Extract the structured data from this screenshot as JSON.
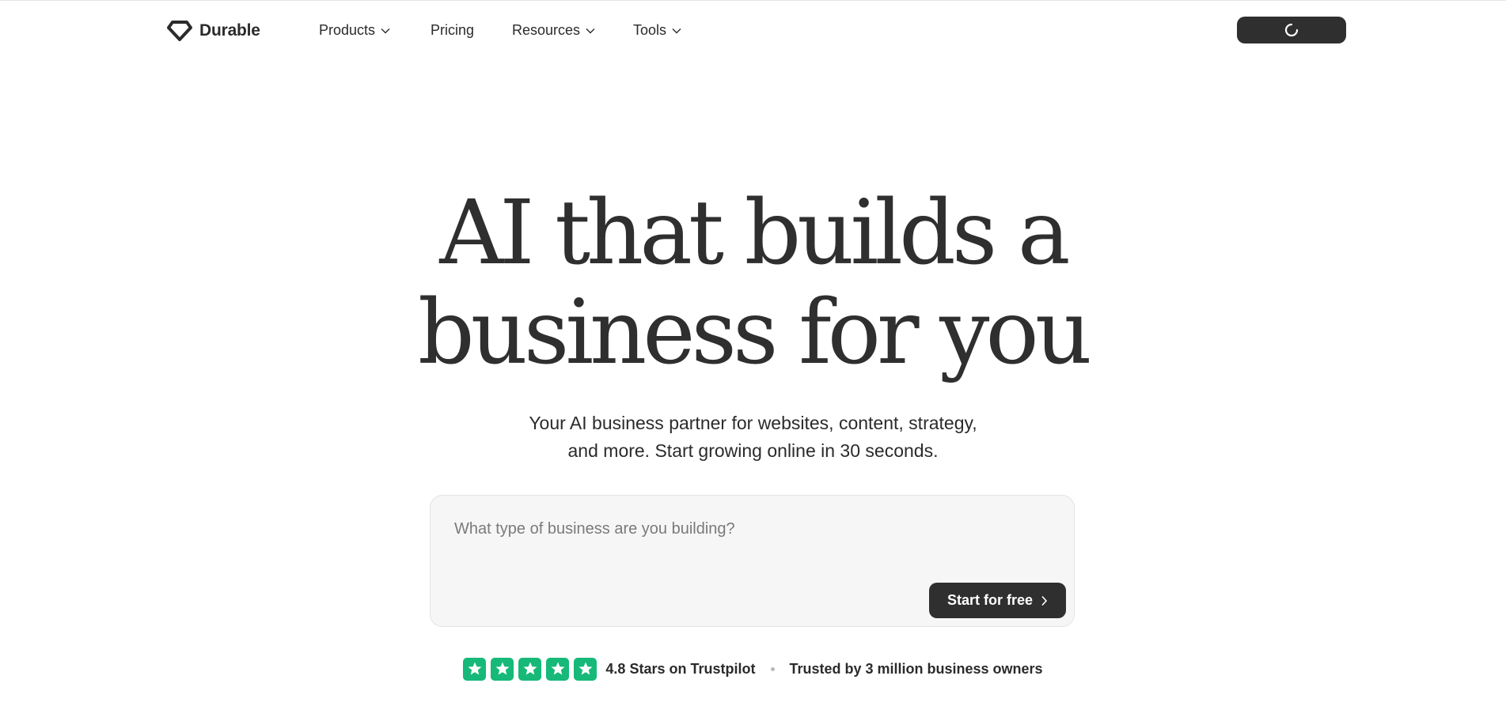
{
  "brand": {
    "name": "Durable",
    "logo_icon": "diamond-logo-icon"
  },
  "nav": {
    "items": [
      {
        "label": "Products",
        "has_dropdown": true
      },
      {
        "label": "Pricing",
        "has_dropdown": false
      },
      {
        "label": "Resources",
        "has_dropdown": true
      },
      {
        "label": "Tools",
        "has_dropdown": true
      }
    ],
    "cta_state_icon": "loading-spinner-icon"
  },
  "hero": {
    "title_line1": "AI that builds a",
    "title_line2": "business for you",
    "subtitle_line1": "Your AI business partner for websites, content, strategy,",
    "subtitle_line2": "and more. Start growing online in 30 seconds."
  },
  "prompt": {
    "value": "",
    "placeholder": "What type of business are you building?",
    "submit_label": "Start for free"
  },
  "trust": {
    "stars_count": 5,
    "rating_text": "4.8 Stars on Trustpilot",
    "trusted_text": "Trusted by 3 million business owners"
  },
  "colors": {
    "text": "#2b2b2b",
    "dark_button": "#2f2f2f",
    "trustpilot_green": "#16b978",
    "input_bg": "#f6f6f6"
  }
}
